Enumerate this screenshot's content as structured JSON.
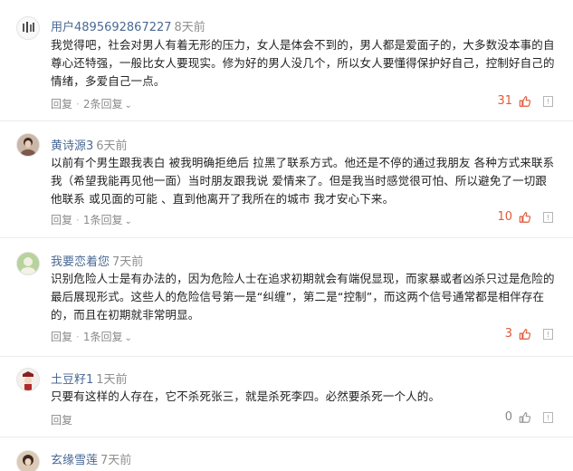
{
  "comments": [
    {
      "username": "用户4895692867227",
      "time": "8天前",
      "text": "我觉得吧，社会对男人有着无形的压力，女人是体会不到的，男人都是爱面子的，大多数没本事的自尊心还特强，一般比女人要现实。修为好的男人没几个，所以女人要懂得保护好自己，控制好自己的情绪，多爱自己一点。",
      "reply_label": "回复",
      "replies_label": "2条回复",
      "likes": "31",
      "liked": true
    },
    {
      "username": "黄诗源3",
      "time": "6天前",
      "text": "以前有个男生跟我表白 被我明确拒绝后 拉黑了联系方式。他还是不停的通过我朋友 各种方式来联系我（希望我能再见他一面）当时朋友跟我说 爱情来了。但是我当时感觉很可怕、所以避免了一切跟他联系 或见面的可能 、直到他离开了我所在的城市 我才安心下来。",
      "reply_label": "回复",
      "replies_label": "1条回复",
      "likes": "10",
      "liked": true
    },
    {
      "username": "我要恋着您",
      "time": "7天前",
      "text": "识别危险人士是有办法的，因为危险人士在追求初期就会有端倪显现，而家暴或者凶杀只过是危险的最后展现形式。这些人的危险信号第一是“纠缠”，第二是“控制”，而这两个信号通常都是相伴存在的，而且在初期就非常明显。",
      "reply_label": "回复",
      "replies_label": "1条回复",
      "likes": "3",
      "liked": true
    },
    {
      "username": "土豆籽1",
      "time": "1天前",
      "text": "只要有这样的人存在，它不杀死张三，就是杀死李四。必然要杀死一个人的。",
      "reply_label": "回复",
      "replies_label": "",
      "likes": "0",
      "liked": false
    },
    {
      "username": "玄缘雪莲",
      "time": "7天前",
      "text": "",
      "reply_label": "",
      "replies_label": "",
      "likes": "",
      "liked": false
    }
  ],
  "icons": {
    "like": "thumbs-up-icon",
    "report": "report-icon",
    "chevron": "chevron-down-icon"
  },
  "colors": {
    "username": "#4a6994",
    "liked": "#e05a3a",
    "muted": "#8a8a8a"
  }
}
